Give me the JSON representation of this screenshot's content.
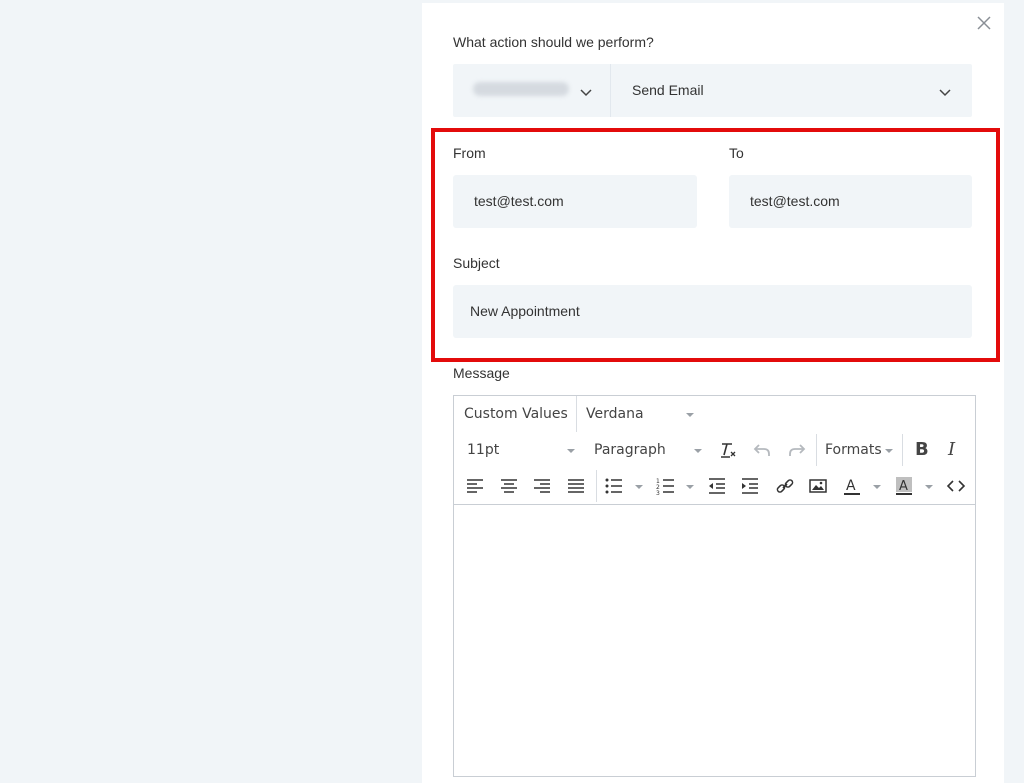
{
  "form": {
    "action_question": "What action should we perform?",
    "action_value": "Send Email",
    "from_label": "From",
    "from_value": "test@test.com",
    "to_label": "To",
    "to_value": "test@test.com",
    "subject_label": "Subject",
    "subject_value": "New Appointment",
    "message_label": "Message"
  },
  "editor": {
    "custom_values": "Custom Values",
    "font_family": "Verdana",
    "font_size": "11pt",
    "block_format": "Paragraph",
    "formats": "Formats",
    "bold": "B",
    "italic": "I"
  },
  "colors": {
    "highlight": "#e30b0b",
    "field_bg": "#f1f5f8",
    "page_bg": "#f1f5f8"
  },
  "icons": [
    "close-icon",
    "chevron-down-icon",
    "clear-format-icon",
    "undo-icon",
    "redo-icon",
    "align-left-icon",
    "align-center-icon",
    "align-right-icon",
    "align-justify-icon",
    "bullet-list-icon",
    "numbered-list-icon",
    "outdent-icon",
    "indent-icon",
    "link-icon",
    "image-icon",
    "text-color-icon",
    "background-color-icon",
    "source-code-icon"
  ]
}
